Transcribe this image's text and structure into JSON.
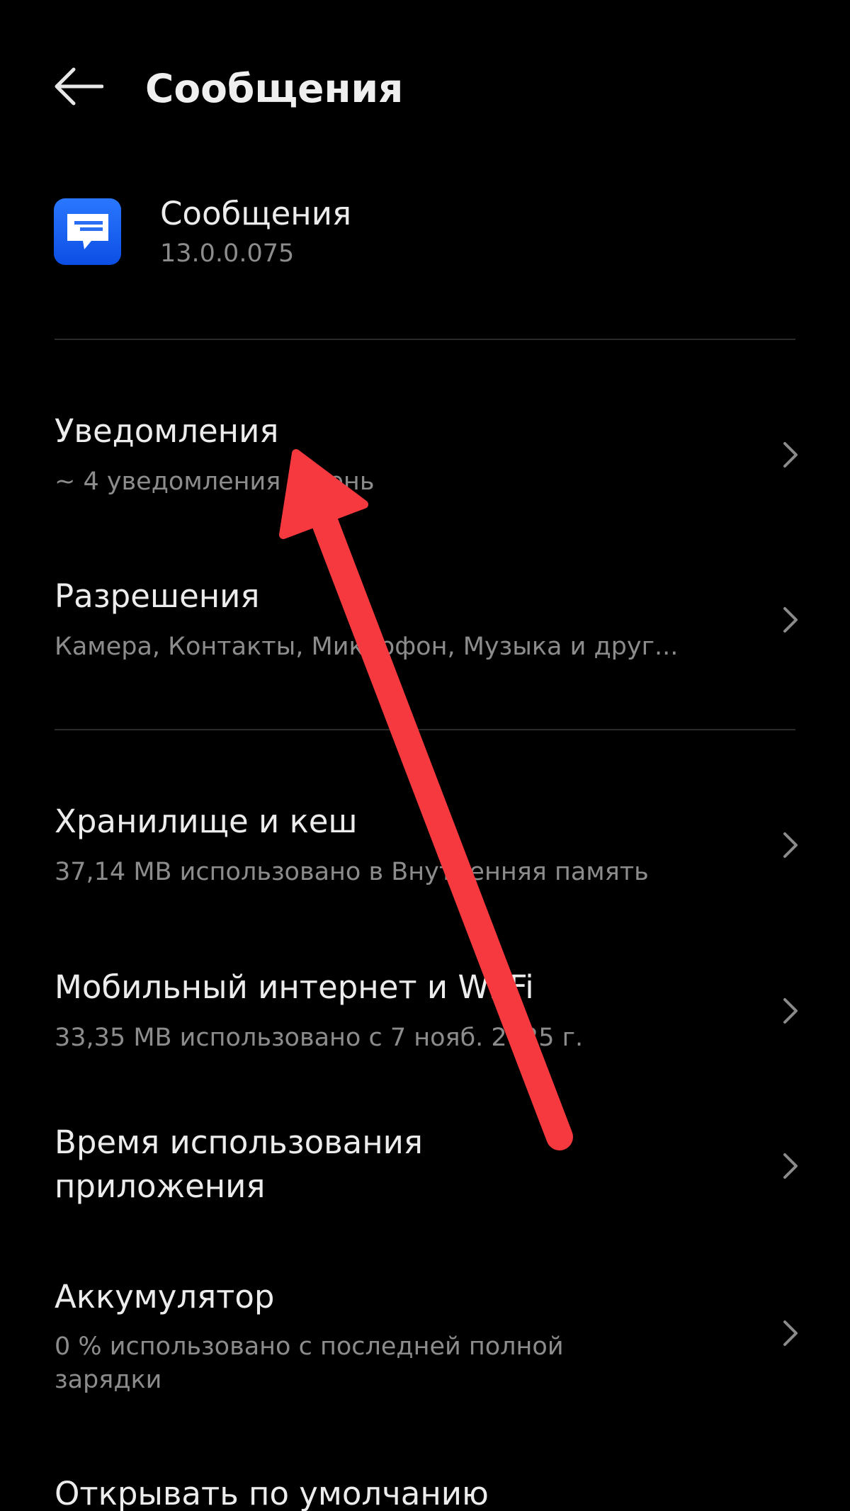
{
  "header": {
    "back_icon": "back-arrow-icon",
    "title": "Сообщения"
  },
  "app": {
    "icon": "messages-app-icon",
    "icon_color": "#1f66f5",
    "name": "Сообщения",
    "version": "13.0.0.075"
  },
  "items": [
    {
      "title": "Уведомления",
      "subtitle": "~ 4 уведомления в день"
    },
    {
      "title": "Разрешения",
      "subtitle": "Камера, Контакты, Микрофон, Музыка и друг..."
    },
    {
      "title": "Хранилище и кеш",
      "subtitle": "37,14 MB использовано в Внутренняя память"
    },
    {
      "title": "Мобильный интернет и Wi-Fi",
      "subtitle": "33,35 MB использовано с 7 нояб. 2025 г."
    },
    {
      "title_line1": "Время использования",
      "title_line2": "приложения"
    },
    {
      "title": "Аккумулятор",
      "subtitle_line1": "0 % использовано с последней полной",
      "subtitle_line2": "зарядки"
    },
    {
      "title": "Открывать по умолчанию"
    }
  ],
  "chevron_icon": "chevron-right-icon",
  "annotation": {
    "icon": "red-arrow-pointer",
    "color": "#f5393f"
  }
}
